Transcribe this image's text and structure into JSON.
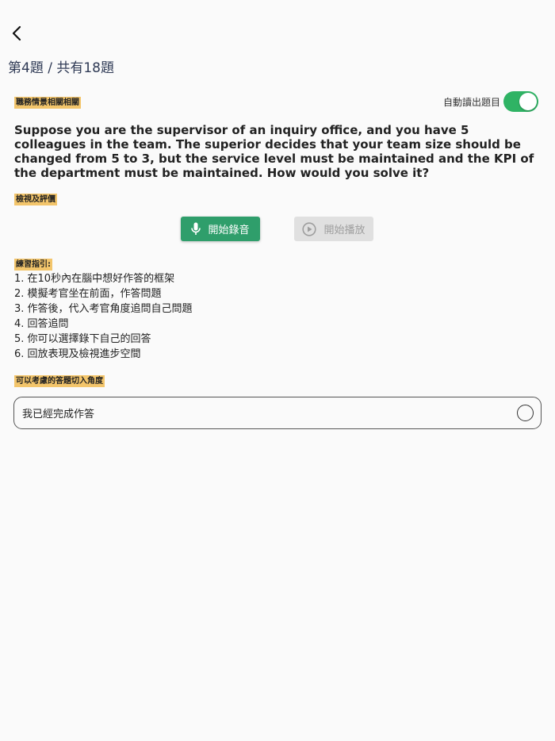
{
  "nav": {
    "back_icon": "chevron-left-icon"
  },
  "progress": {
    "label": "第4題 / 共有18題"
  },
  "question": {
    "category": "職務情景相關相關",
    "autoread_label": "自動讀出題目",
    "autoread_on": true,
    "text": "Suppose you are the supervisor of an inquiry office, and you have 5 colleagues in the team. The superior decides that your team size should be changed from 5 to 3, but the service level must be maintained and the KPI of the department must be maintained. How would you solve it?"
  },
  "review": {
    "title": "檢視及評價",
    "record_label": "開始錄音",
    "record_icon": "microphone-icon",
    "play_label": "開始播放",
    "play_icon": "play-circle-icon",
    "play_enabled": false
  },
  "guide": {
    "title": "練習指引:",
    "items": [
      "1. 在10秒內在腦中想好作答的框架",
      "2. 模擬考官坐在前面，作答問題",
      "3. 作答後，代入考官角度追問自己問題",
      "4. 回答追問",
      "5. 你可以選擇錄下自己的回答",
      "6. 回放表現及檢視進步空間"
    ]
  },
  "angle": {
    "title": "可以考慮的答題切入角度"
  },
  "complete": {
    "label": "我已經完成作答",
    "checked": false
  },
  "colors": {
    "accent_green": "#2fb364",
    "record_button": "#2f9e6b",
    "highlight": "#f3c56b"
  }
}
